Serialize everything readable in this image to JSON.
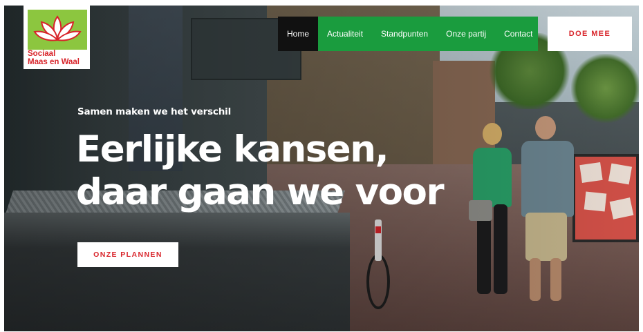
{
  "logo": {
    "line1": "Sociaal",
    "line2": "Maas en Waal",
    "icon": "lotus-flower-icon",
    "colors": {
      "green": "#8cc63f",
      "red": "#d8242a"
    }
  },
  "nav": {
    "items": [
      {
        "label": "Home",
        "active": true
      },
      {
        "label": "Actualiteit",
        "active": false
      },
      {
        "label": "Standpunten",
        "active": false
      },
      {
        "label": "Onze partij",
        "active": false
      },
      {
        "label": "Contact",
        "active": false
      }
    ],
    "background": "#1a9c3e",
    "active_background": "#111111"
  },
  "cta_top": {
    "label": "DOE MEE"
  },
  "hero": {
    "tagline": "Samen maken we het verschil",
    "headline_line1": "Eerlijke kansen,",
    "headline_line2": "daar gaan we voor",
    "button_label": "ONZE PLANNEN"
  },
  "colors": {
    "accent_red": "#d8242a",
    "nav_green": "#1a9c3e",
    "white": "#ffffff"
  }
}
